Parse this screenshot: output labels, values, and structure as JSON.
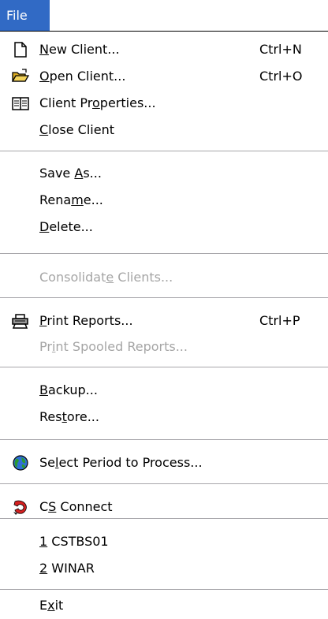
{
  "menubar": {
    "file_label": "File"
  },
  "items": {
    "new_client": {
      "before": "",
      "key": "N",
      "after": "ew Client...",
      "shortcut": "Ctrl+N"
    },
    "open_client": {
      "before": "",
      "key": "O",
      "after": "pen Client...",
      "shortcut": "Ctrl+O"
    },
    "client_properties": {
      "before": "Client Pr",
      "key": "o",
      "after": "perties..."
    },
    "close_client": {
      "before": "",
      "key": "C",
      "after": "lose Client"
    },
    "save_as": {
      "before": "Save ",
      "key": "A",
      "after": "s..."
    },
    "rename": {
      "before": "Rena",
      "key": "m",
      "after": "e..."
    },
    "delete": {
      "before": "",
      "key": "D",
      "after": "elete..."
    },
    "consolidate_clients": {
      "before": "Consolidat",
      "key": "e",
      "after": " Clients..."
    },
    "print_reports": {
      "before": "",
      "key": "P",
      "after": "rint Reports...",
      "shortcut": "Ctrl+P"
    },
    "print_spooled_reports": {
      "before": "Pr",
      "key": "i",
      "after": "nt Spooled Reports..."
    },
    "backup": {
      "before": "",
      "key": "B",
      "after": "ackup..."
    },
    "restore": {
      "before": "Res",
      "key": "t",
      "after": "ore..."
    },
    "select_period": {
      "before": "Se",
      "key": "l",
      "after": "ect Period to Process..."
    },
    "cs_connect": {
      "before": "C",
      "key": "S",
      "after": " Connect"
    },
    "recent_1": {
      "before": "",
      "key": "1",
      "after": " CSTBS01"
    },
    "recent_2": {
      "before": "",
      "key": "2",
      "after": " WINAR"
    },
    "exit": {
      "before": "E",
      "key": "x",
      "after": "it"
    }
  },
  "icons": {
    "new_client": "new-document-icon",
    "open_client": "open-folder-icon",
    "client_properties": "book-icon",
    "print_reports": "printer-icon",
    "select_period": "globe-icon",
    "cs_connect": "cs-connect-icon"
  },
  "colors": {
    "highlight": "#316ac5",
    "disabled_text": "#a5a5a5",
    "separator": "#a7a6aa"
  }
}
